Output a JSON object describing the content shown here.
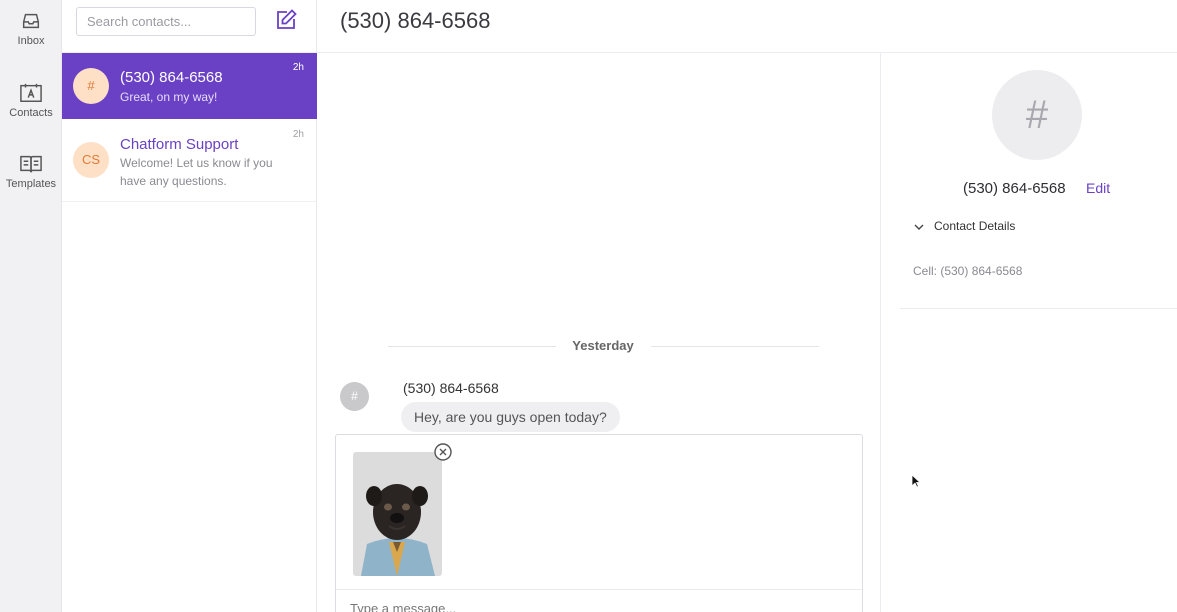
{
  "nav": {
    "inbox_label": "Inbox",
    "contacts_label": "Contacts",
    "templates_label": "Templates"
  },
  "search": {
    "placeholder": "Search contacts..."
  },
  "conversations": [
    {
      "avatar": "#",
      "name": "(530) 864-6568",
      "snippet": "Great, on my way!",
      "time": "2h",
      "active": true
    },
    {
      "avatar": "CS",
      "name": "Chatform Support",
      "snippet": "Welcome! Let us know if you have any questions.",
      "time": "2h",
      "active": false
    }
  ],
  "header": {
    "title": "(530) 864-6568"
  },
  "chat": {
    "day_separator": "Yesterday",
    "messages": [
      {
        "avatar": "#",
        "sender": "(530) 864-6568",
        "text": "Hey, are you guys open today?"
      }
    ]
  },
  "composer": {
    "placeholder": "Type a message..."
  },
  "contact_panel": {
    "avatar": "#",
    "name": "(530) 864-6568",
    "edit_label": "Edit",
    "details_label": "Contact Details",
    "cell": "Cell: (530) 864-6568"
  },
  "colors": {
    "accent": "#6a41c4",
    "avatar_bg": "#fde0c6",
    "avatar_text": "#e07b38"
  },
  "icons": {
    "inbox": "inbox-icon",
    "contacts": "contacts-icon",
    "templates": "templates-icon",
    "compose": "compose-icon",
    "remove_attachment": "close-circle-icon",
    "details_toggle": "chevron-down-icon"
  }
}
